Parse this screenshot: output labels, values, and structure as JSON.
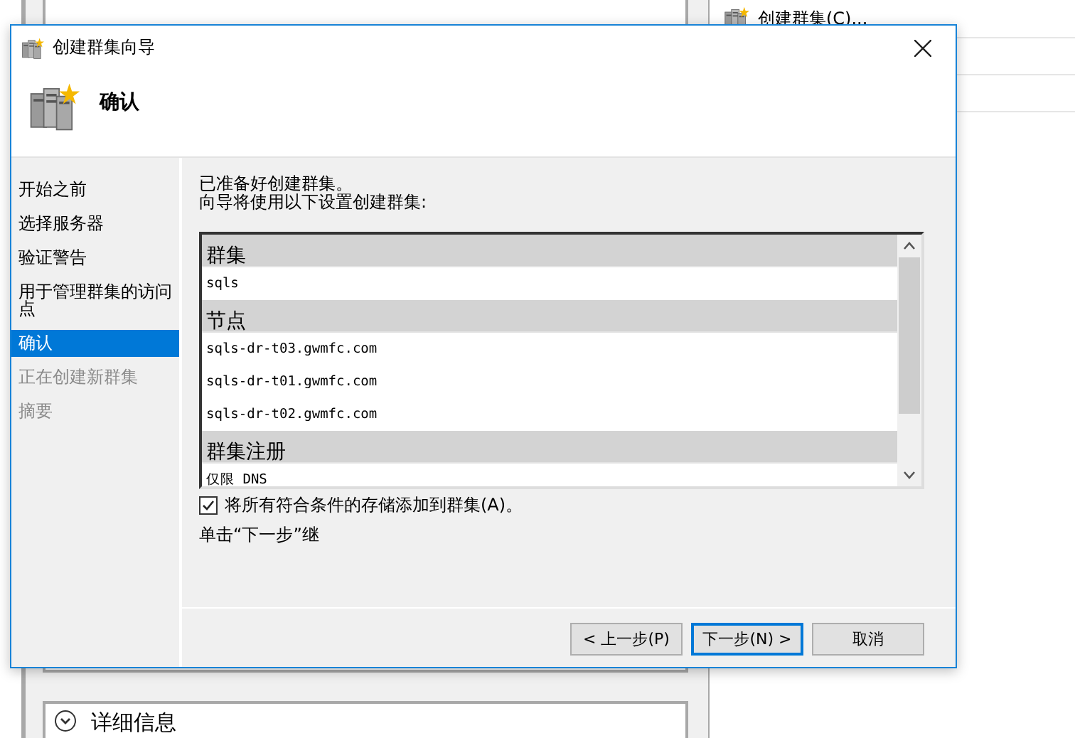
{
  "background": {
    "actions": [
      {
        "label": "创建群集(C)..."
      }
    ],
    "details_section": {
      "label": "详细信息",
      "expanded": false
    }
  },
  "dialog": {
    "title": "创建群集向导",
    "heading": "确认",
    "steps": [
      {
        "label": "开始之前",
        "selected": false,
        "disabled": false
      },
      {
        "label": "选择服务器",
        "selected": false,
        "disabled": false
      },
      {
        "label": "验证警告",
        "selected": false,
        "disabled": false
      },
      {
        "label": "用于管理群集的访问点",
        "selected": false,
        "disabled": false
      },
      {
        "label": "确认",
        "selected": true,
        "disabled": false
      },
      {
        "label": "正在创建新群集",
        "selected": false,
        "disabled": true
      },
      {
        "label": "摘要",
        "selected": false,
        "disabled": true
      }
    ],
    "intro": [
      "已准备好创建群集。",
      "向导将使用以下设置创建群集:"
    ],
    "summary": [
      {
        "kind": "header",
        "text": "群集"
      },
      {
        "kind": "item",
        "text": "sqls"
      },
      {
        "kind": "header",
        "text": "节点"
      },
      {
        "kind": "item",
        "text": "sqls-dr-t03.gwmfc.com"
      },
      {
        "kind": "item",
        "text": "sqls-dr-t01.gwmfc.com"
      },
      {
        "kind": "item",
        "text": "sqls-dr-t02.gwmfc.com"
      },
      {
        "kind": "header",
        "text": "群集注册"
      },
      {
        "kind": "item",
        "text": "仅限 DNS"
      }
    ],
    "checkbox": {
      "label": "将所有符合条件的存储添加到群集(A)。",
      "checked": true
    },
    "note": "单击“下一步”继",
    "buttons": [
      {
        "label": "< 上一步(P)",
        "focused": false
      },
      {
        "label": "下一步(N) >",
        "focused": true
      },
      {
        "label": "取消",
        "focused": false
      }
    ]
  }
}
